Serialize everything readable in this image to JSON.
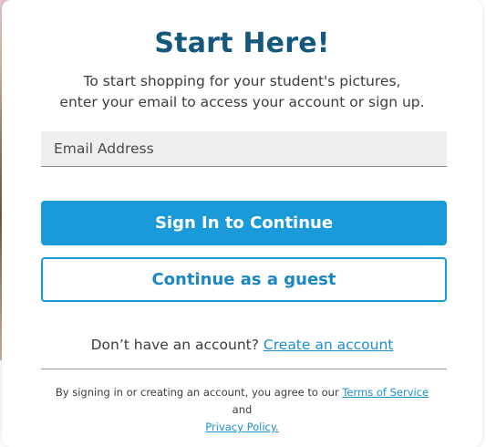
{
  "dialog": {
    "title": "Start Here!",
    "subtitle_line1": "To start shopping for your student's pictures,",
    "subtitle_line2": "enter your email to access your account or sign up."
  },
  "email_field": {
    "placeholder": "Email Address",
    "value": ""
  },
  "buttons": {
    "sign_in": "Sign In to Continue",
    "guest": "Continue as a guest"
  },
  "signup": {
    "prompt": "Don’t have an account?",
    "link": "Create an account"
  },
  "legal": {
    "prefix": "By signing in or creating an account, you agree to our",
    "terms_link": "Terms of Service",
    "and": "and",
    "privacy_link": "Privacy Policy."
  },
  "colors": {
    "title": "#15587d",
    "accent": "#1a9ad9",
    "link": "#1a8fcf",
    "input_bg": "#eeeff0"
  }
}
